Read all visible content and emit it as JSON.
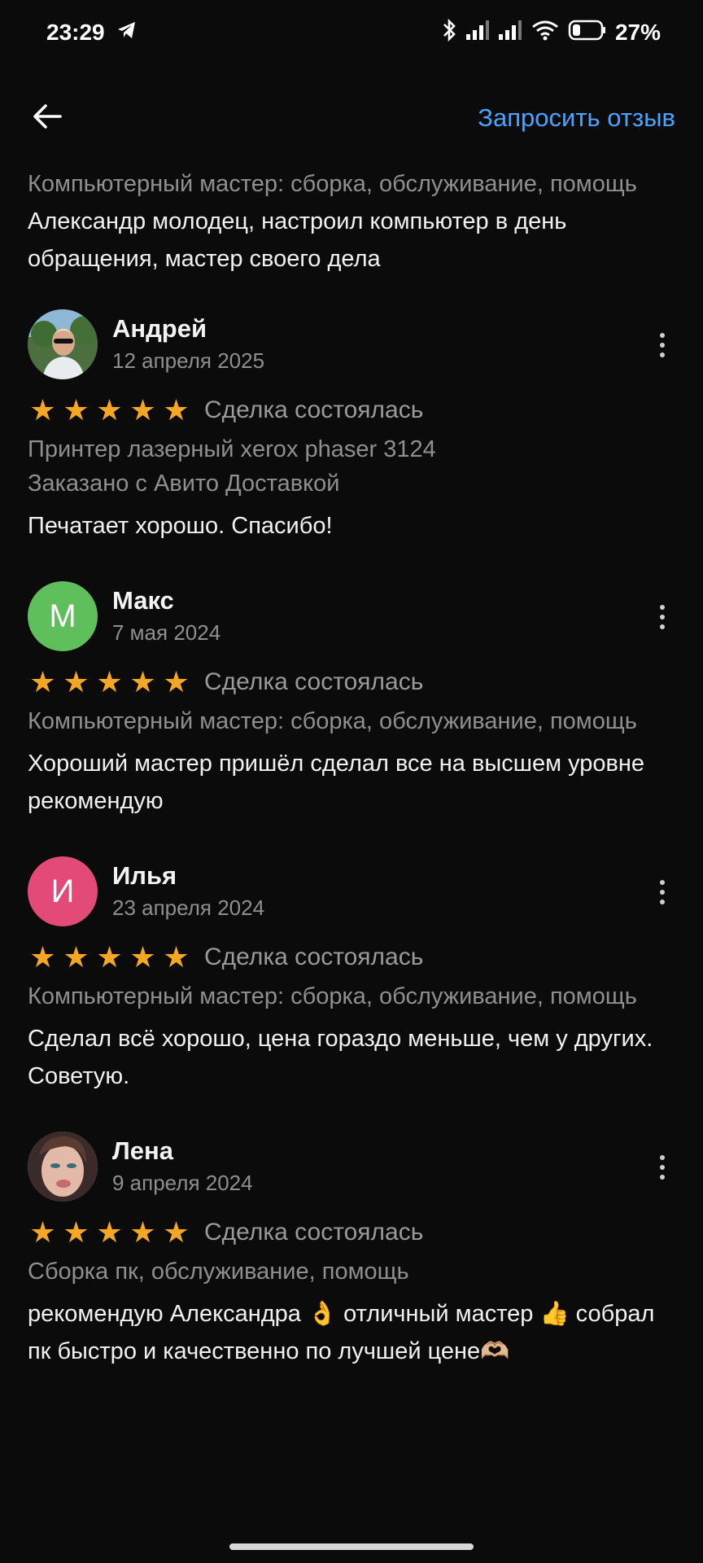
{
  "status_bar": {
    "time": "23:29",
    "telegram_icon": "telegram-icon",
    "bluetooth_icon": "bluetooth-icon",
    "signal_icons": [
      "signal-icon",
      "signal-icon"
    ],
    "wifi_icon": "wifi-icon",
    "battery_icon": "battery-icon",
    "battery": "27%"
  },
  "header": {
    "back_icon": "arrow-left-icon",
    "request_review": "Запросить отзыв"
  },
  "partial_review": {
    "service": "Компьютерный мастер: сборка, обслуживание, помощь",
    "text": "Александр молодец, настроил компьютер в день обращения, мастер своего дела"
  },
  "reviews": [
    {
      "name": "Андрей",
      "date": "12 апреля 2025",
      "avatar_type": "photo",
      "deal": "Сделка состоялась",
      "rating": 5,
      "service": "Принтер лазерный xerox phaser 3124",
      "delivery": "Заказано с Авито Доставкой",
      "text": "Печатает хорошо. Спасибо!"
    },
    {
      "name": "Макс",
      "date": "7 мая 2024",
      "avatar_letter": "М",
      "avatar_color": "#5fbf5a",
      "deal": "Сделка состоялась",
      "rating": 5,
      "service": "Компьютерный мастер: сборка, обслуживание, помощь",
      "text": "Хороший мастер пришёл сделал все на высшем уровне рекомендую"
    },
    {
      "name": "Илья",
      "date": "23 апреля 2024",
      "avatar_letter": "И",
      "avatar_color": "#e34a78",
      "deal": "Сделка состоялась",
      "rating": 5,
      "service": "Компьютерный мастер: сборка, обслуживание, помощь",
      "text": "Сделал всё хорошо, цена гораздо меньше, чем у других. Советую."
    },
    {
      "name": "Лена",
      "date": "9 апреля 2024",
      "avatar_type": "photo",
      "deal": "Сделка состоялась",
      "rating": 5,
      "service": "Сборка пк, обслуживание, помощь",
      "text": "рекомендую Александра 👌 отличный мастер 👍 собрал пк быстро и качественно по лучшей цене🫶🏼"
    }
  ],
  "star_char": "★",
  "colors": {
    "accent": "#4aa3ff",
    "star": "#f5a623",
    "background": "#0b0b0b"
  }
}
